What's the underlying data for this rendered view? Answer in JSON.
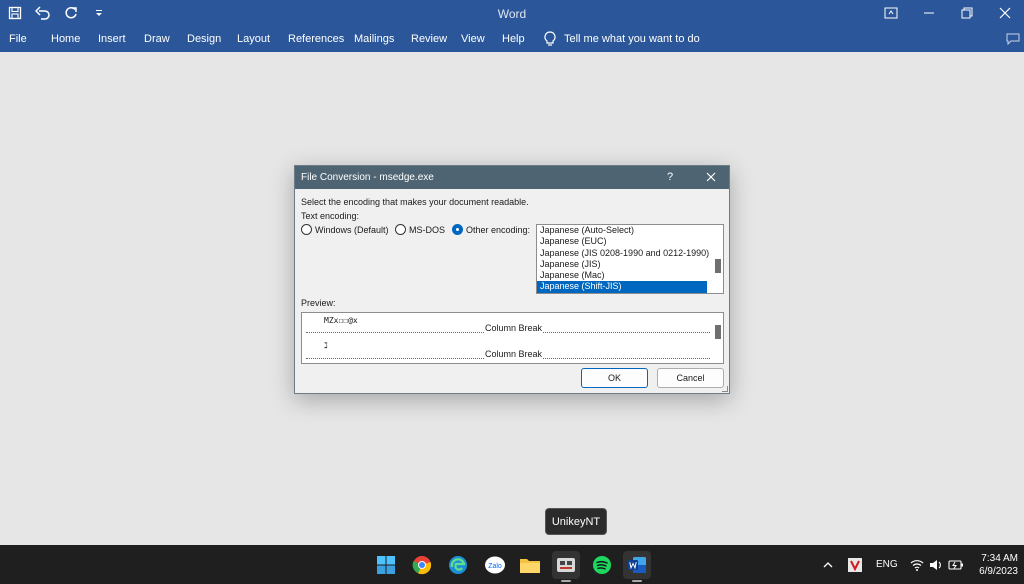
{
  "window": {
    "title": "Word",
    "qat_icons": [
      "save-icon",
      "undo-icon",
      "redo-icon",
      "customize-icon"
    ]
  },
  "ribbon": {
    "tabs": [
      "File",
      "Home",
      "Insert",
      "Draw",
      "Design",
      "Layout",
      "References",
      "Mailings",
      "Review",
      "View",
      "Help"
    ],
    "tell_me": "Tell me what you want to do"
  },
  "dialog": {
    "title": "File Conversion - msedge.exe",
    "help": "?",
    "instruction": "Select the encoding that makes your document readable.",
    "text_encoding_label": "Text encoding:",
    "radios": [
      {
        "label": "Windows (Default)",
        "checked": false
      },
      {
        "label": "MS-DOS",
        "checked": false
      },
      {
        "label": "Other encoding:",
        "checked": true
      }
    ],
    "encodings": [
      "Japanese (Auto-Select)",
      "Japanese (EUC)",
      "Japanese (JIS 0208-1990 and 0212-1990)",
      "Japanese (JIS)",
      "Japanese (Mac)",
      "Japanese (Shift-JIS)"
    ],
    "selected_encoding": "Japanese (Shift-JIS)",
    "preview_label": "Preview:",
    "preview_lines": [
      "MZx☐☐@x",
      "ℷ"
    ],
    "column_break": "Column Break",
    "ok": "OK",
    "cancel": "Cancel"
  },
  "tooltip": "UnikeyNT",
  "taskbar": {
    "apps": [
      "windows-start-icon",
      "chrome-icon",
      "edge-icon",
      "zalo-icon",
      "file-explorer-icon",
      "unikey-icon",
      "spotify-icon",
      "word-icon"
    ],
    "zalo_text": "Zalo",
    "tray": {
      "language": "ENG",
      "time": "7:34 AM",
      "date": "6/9/2023"
    }
  },
  "colors": {
    "word_blue": "#2b579a",
    "dialog_title": "#4f6473",
    "selection": "#0067c0",
    "taskbar": "#1f1f1f"
  }
}
